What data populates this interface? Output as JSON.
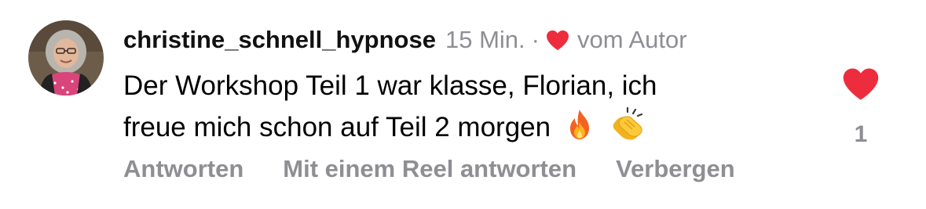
{
  "comment": {
    "username": "christine_schnell_hypnose",
    "time": "15 Min.",
    "separator": "·",
    "author_label": "vom Autor",
    "text_line1": "Der Workshop Teil 1 war klasse, Florian, ich",
    "text_line2": "freue mich schon auf Teil 2 morgen",
    "emojis": [
      "fire-emoji",
      "clapping-hands-emoji"
    ],
    "like_count": "1",
    "liked": true,
    "liked_by_author": true
  },
  "actions": {
    "reply": "Antworten",
    "reply_reel": "Mit einem Reel antworten",
    "hide": "Verbergen"
  },
  "colors": {
    "heart": "#ed2d3d",
    "muted_text": "#8e8e93",
    "primary_text": "#000000"
  }
}
